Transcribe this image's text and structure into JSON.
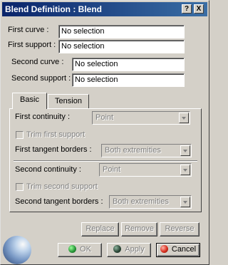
{
  "window": {
    "title": "Blend Definition : Blend",
    "help_label": "?",
    "close_label": "X"
  },
  "fields": {
    "first_curve": {
      "label": "First curve :",
      "value": "No selection"
    },
    "first_support": {
      "label": "First support :",
      "value": "No selection"
    },
    "second_curve": {
      "label": "Second curve :",
      "value": "No selection"
    },
    "second_support": {
      "label": "Second support :",
      "value": "No selection"
    }
  },
  "tabs": [
    {
      "label": "Basic",
      "active": true
    },
    {
      "label": "Tension",
      "active": false
    }
  ],
  "basic": {
    "first_continuity": {
      "label": "First continuity :",
      "value": "Point"
    },
    "trim_first_support": {
      "label": "Trim first support",
      "checked": false
    },
    "first_tangent_borders": {
      "label": "First tangent borders :",
      "value": "Both extremities"
    },
    "second_continuity": {
      "label": "Second continuity :",
      "value": "Point"
    },
    "trim_second_support": {
      "label": "Trim second support",
      "checked": false
    },
    "second_tangent_borders": {
      "label": "Second tangent borders :",
      "value": "Both extremities"
    }
  },
  "actions": {
    "replace": "Replace",
    "remove": "Remove",
    "reverse": "Reverse"
  },
  "dialog_buttons": {
    "ok": {
      "label": "OK",
      "icon": "green-dot-icon",
      "color": "#2a9a3a"
    },
    "apply": {
      "label": "Apply",
      "icon": "dark-green-dot-icon",
      "color": "#2e4a3a"
    },
    "cancel": {
      "label": "Cancel",
      "icon": "red-dot-icon",
      "color": "#d83020"
    }
  },
  "colors": {
    "title_start": "#0a246a",
    "title_end": "#3a6ea5",
    "face": "#d4d0c8"
  }
}
